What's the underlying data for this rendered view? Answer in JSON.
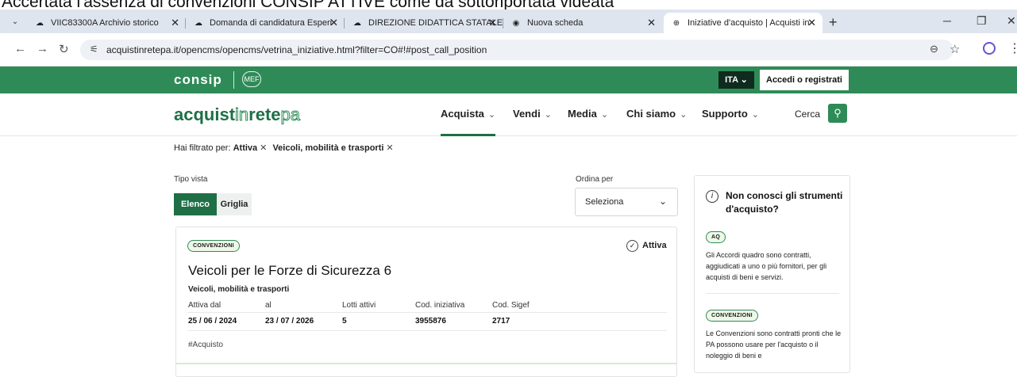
{
  "caption": "Accertata l'assenza di convenzioni CONSIP ATTIVE come da sottoriportata videata",
  "browser": {
    "tabs": [
      {
        "label": "VIIC83300A Archivio storico",
        "active": false
      },
      {
        "label": "Domanda di candidatura Esperi",
        "active": false
      },
      {
        "label": "DIREZIONE DIDATTICA STATALE",
        "active": false
      },
      {
        "label": "Nuova scheda",
        "active": false
      },
      {
        "label": "Iniziative d'acquisto | Acquisti in",
        "active": true
      }
    ],
    "url": "acquistinretepa.it/opencms/opencms/vetrina_iniziative.html?filter=CO#!#post_call_position"
  },
  "topbar": {
    "brand": "cоnsip",
    "mef": "MEF",
    "lang": "ITA",
    "login": "Accedi o registrati"
  },
  "nav": {
    "logo_a": "acquist",
    "logo_b": "in",
    "logo_c": "rete",
    "logo_d": "pa",
    "items": [
      "Acquista",
      "Vendi",
      "Media",
      "Chi siamo",
      "Supporto"
    ],
    "search_label": "Cerca"
  },
  "filters": {
    "prefix": "Hai filtrato per:",
    "chip1": "Attiva",
    "chip2": "Veicoli, mobilità e trasporti"
  },
  "view": {
    "label": "Tipo vista",
    "opt1": "Elenco",
    "opt2": "Griglia",
    "sort_label": "Ordina per",
    "sort_value": "Seleziona"
  },
  "card": {
    "badge": "CONVENZIONI",
    "status": "Attiva",
    "title": "Veicoli per le Forze di Sicurezza 6",
    "category": "Veicoli, mobilità e trasporti",
    "fields": [
      {
        "label": "Attiva dal",
        "value": "25 / 06 / 2024"
      },
      {
        "label": "al",
        "value": "23 / 07 / 2026"
      },
      {
        "label": "Lotti attivi",
        "value": "5"
      },
      {
        "label": "Cod. iniziativa",
        "value": "3955876"
      },
      {
        "label": "Cod. Sigef",
        "value": "2717"
      }
    ],
    "tag": "#Acquisto"
  },
  "sidebar": {
    "title": "Non conosci gli strumenti d'acquisto?",
    "aq_badge": "AQ",
    "aq_text": "Gli Accordi quadro sono contratti, aggiudicati a uno o più fornitori, per gli acquisti di beni e servizi.",
    "conv_badge": "CONVENZIONI",
    "conv_text": "Le Convenzioni sono contratti pronti che le PA possono usare per l'acquisto o il noleggio di beni e"
  }
}
